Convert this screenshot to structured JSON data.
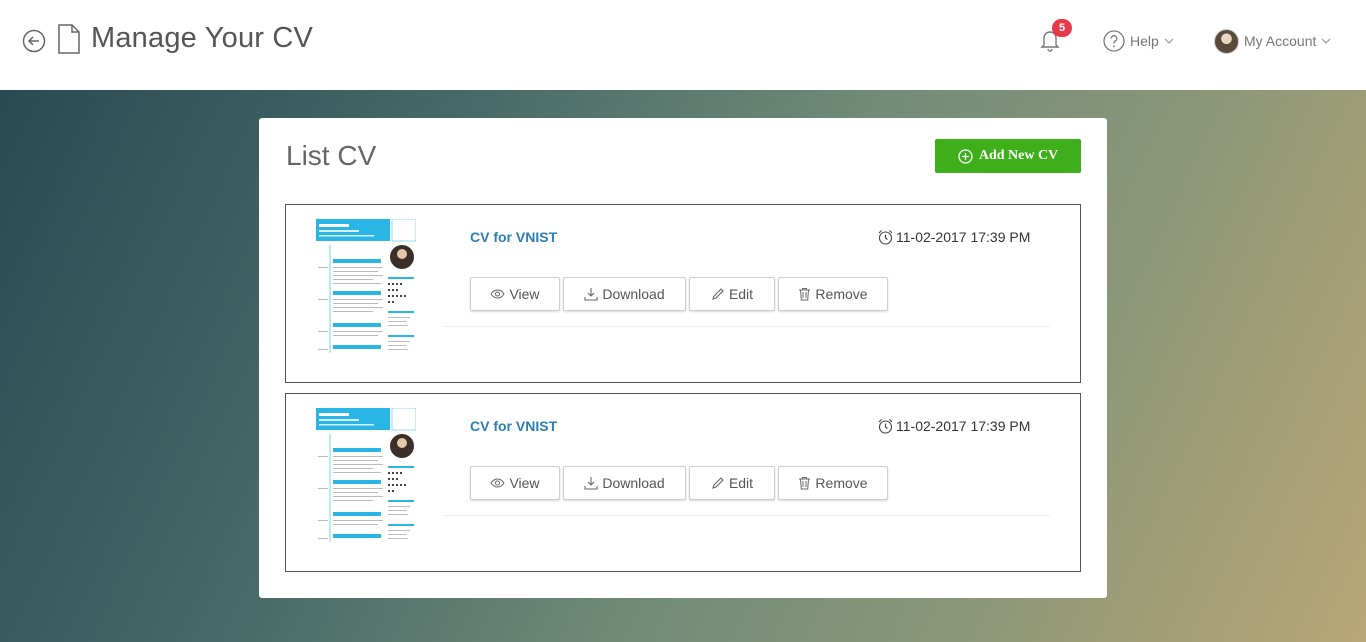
{
  "header": {
    "title": "Manage Your CV",
    "notifications_count": "5",
    "help_label": "Help",
    "account_label": "My Account"
  },
  "panel": {
    "title": "List CV",
    "add_button_label": "Add New CV"
  },
  "cvs": [
    {
      "name": "CV for VNIST",
      "timestamp": "11-02-2017 17:39 PM"
    },
    {
      "name": "CV for VNIST",
      "timestamp": "11-02-2017 17:39 PM"
    }
  ],
  "actions": {
    "view": "View",
    "download": "Download",
    "edit": "Edit",
    "remove": "Remove"
  },
  "colors": {
    "accent_green": "#3eae1b",
    "link_blue": "#2b7fb3",
    "badge_red": "#e8394a",
    "cv_template_blue": "#29b6e6"
  }
}
